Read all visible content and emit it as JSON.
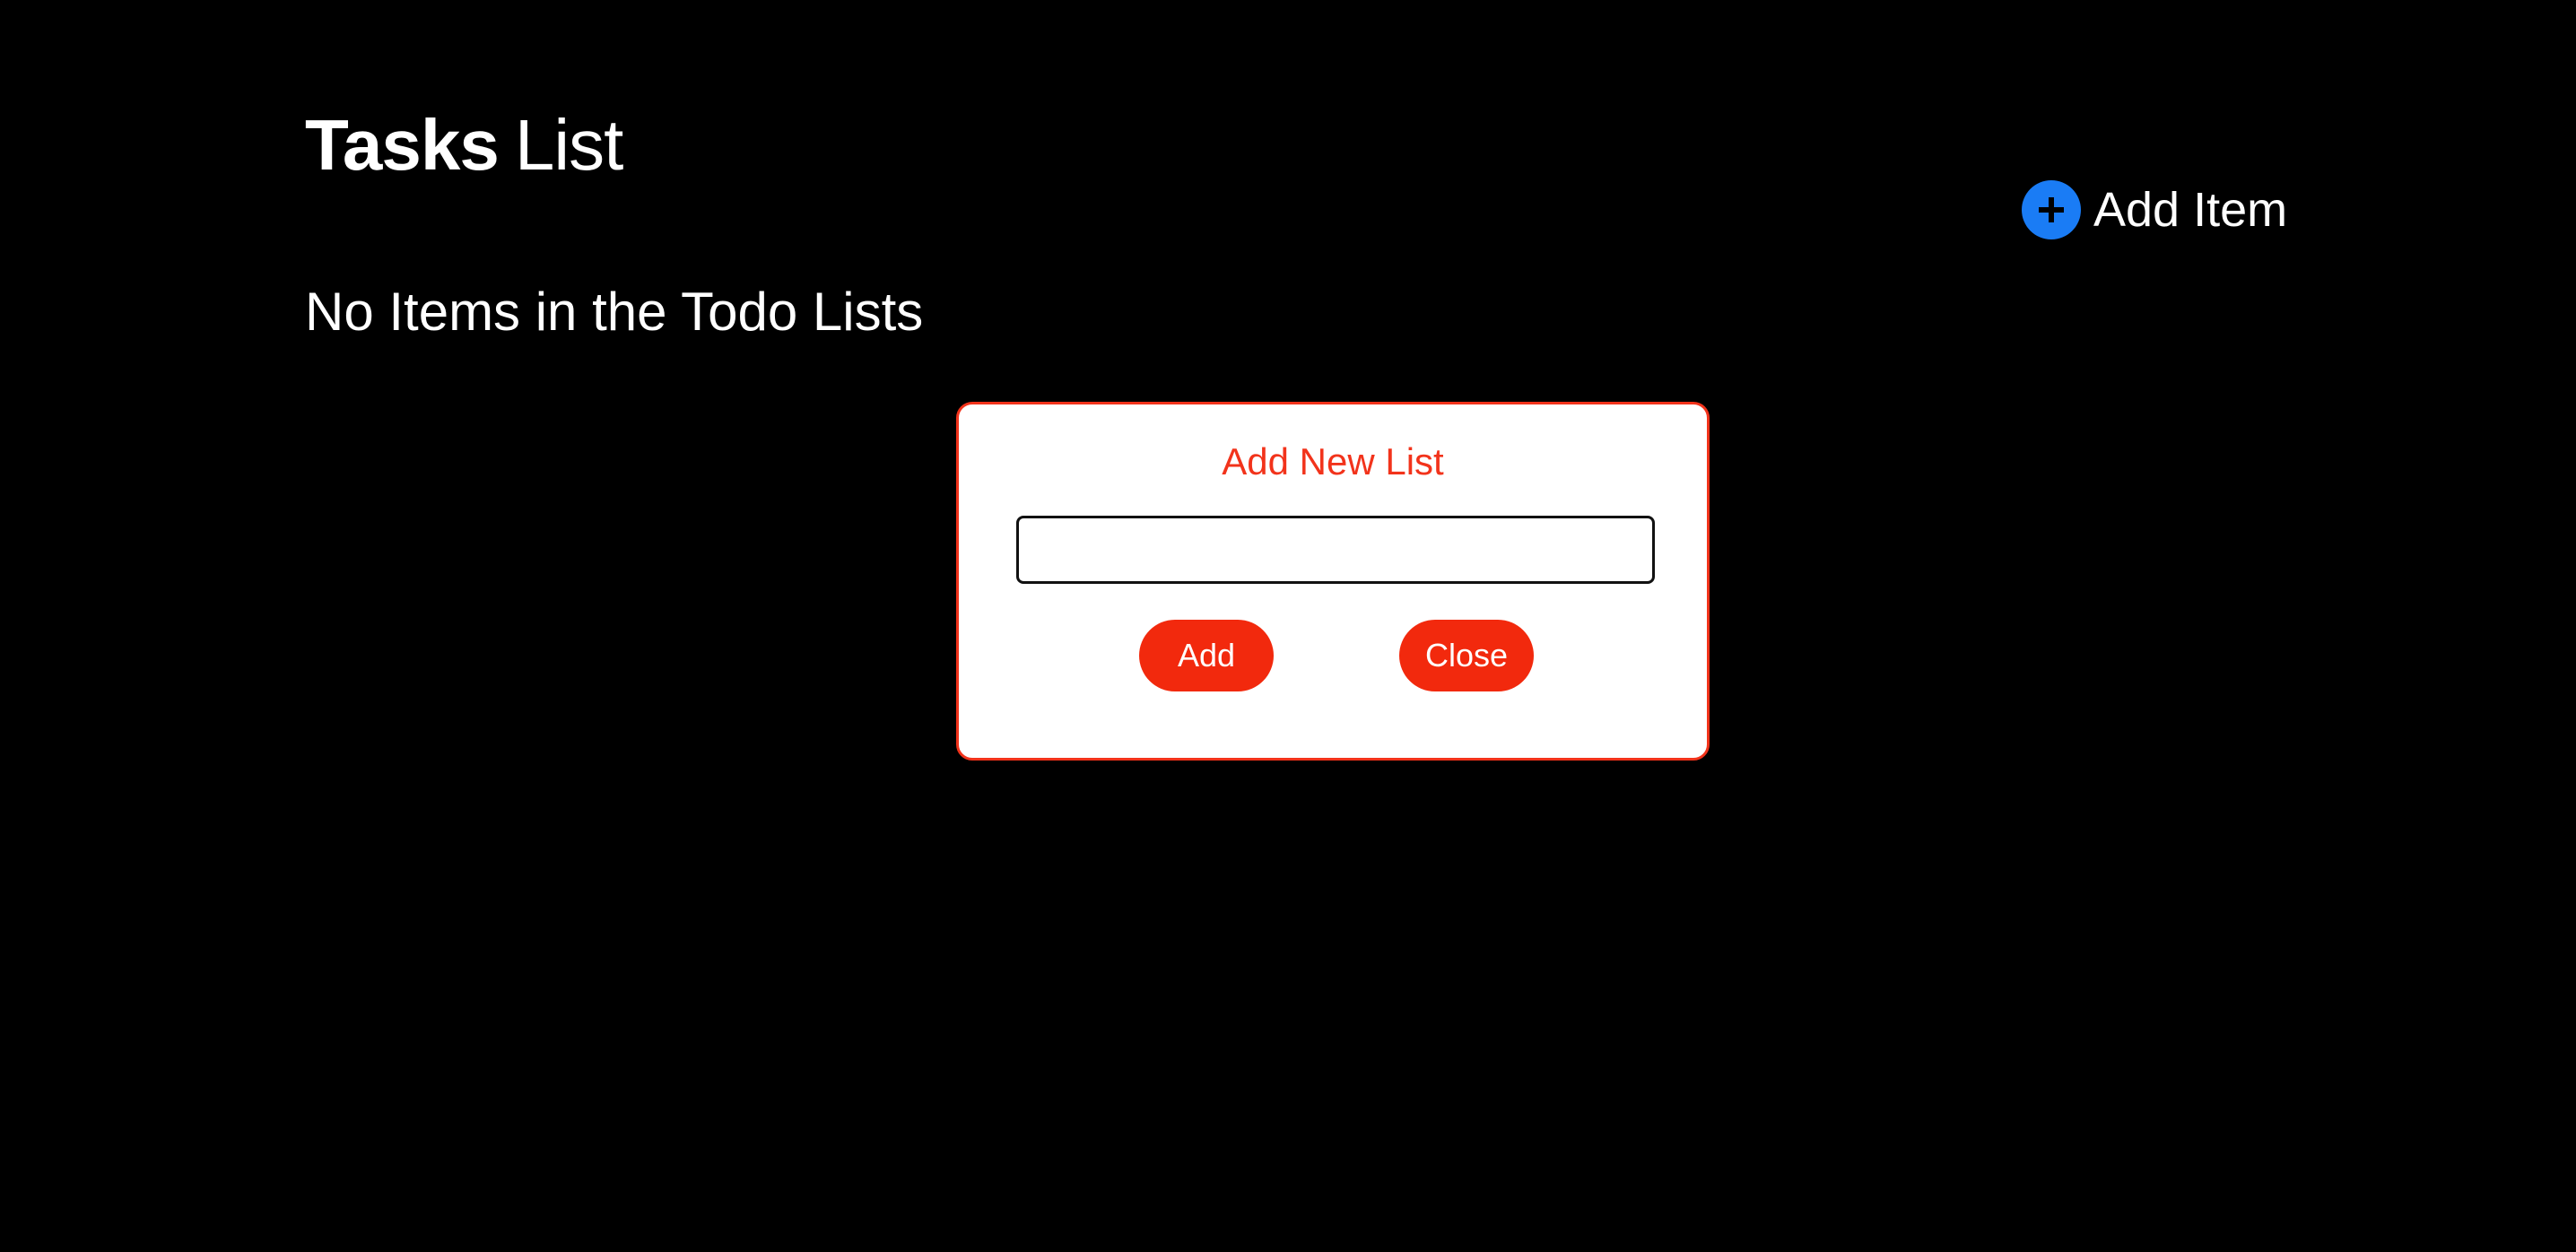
{
  "header": {
    "title_bold": "Tasks",
    "title_light": "List"
  },
  "add_item": {
    "label": "Add Item",
    "icon": "plus-circle-icon",
    "icon_color": "#1a7cf5"
  },
  "main": {
    "empty_message": "No Items in the Todo Lists"
  },
  "modal": {
    "title": "Add New List",
    "input_value": "",
    "input_placeholder": "",
    "add_label": "Add",
    "close_label": "Close",
    "accent_color": "#f2331b"
  },
  "colors": {
    "background": "#000000",
    "text": "#ffffff"
  }
}
